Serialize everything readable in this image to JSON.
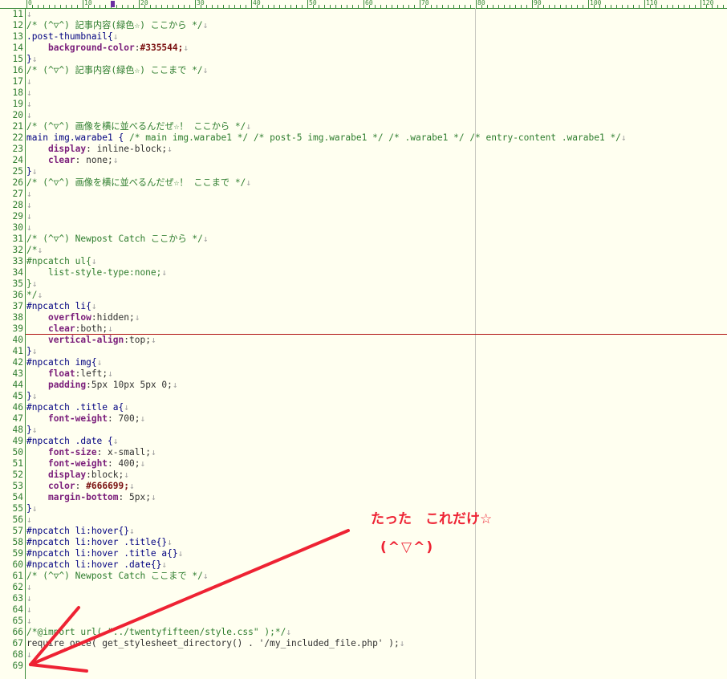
{
  "ruler": {
    "labels": [
      "0",
      "10",
      "20",
      "30",
      "40",
      "50",
      "60",
      "70",
      "80",
      "90",
      "100",
      "110",
      "120"
    ]
  },
  "eol_glyph": "↓",
  "lines": [
    {
      "n": "11",
      "t": [],
      "eol": true
    },
    {
      "n": "12",
      "t": [
        [
          "c-comment",
          "/* (^▽^) 記事内容(緑色☆) ここから */"
        ]
      ],
      "eol": true
    },
    {
      "n": "13",
      "t": [
        [
          "c-sel",
          ".post-thumbnail{"
        ]
      ],
      "eol": true
    },
    {
      "n": "14",
      "t": [
        [
          "",
          "    "
        ],
        [
          "c-prop",
          "background-color"
        ],
        [
          "c-punc",
          ":"
        ],
        [
          "c-color",
          "#335544;"
        ]
      ],
      "eol": true
    },
    {
      "n": "15",
      "t": [
        [
          "c-sel",
          "}"
        ]
      ],
      "eol": true
    },
    {
      "n": "16",
      "t": [
        [
          "c-comment",
          "/* (^▽^) 記事内容(緑色☆) ここまで */"
        ]
      ],
      "eol": true
    },
    {
      "n": "17",
      "t": [],
      "eol": true
    },
    {
      "n": "18",
      "t": [],
      "eol": true
    },
    {
      "n": "19",
      "t": [],
      "eol": true
    },
    {
      "n": "20",
      "t": [],
      "eol": true
    },
    {
      "n": "21",
      "t": [
        [
          "c-comment",
          "/* (^▽^) 画像を横に並べるんだぜ☆！ ここから */"
        ]
      ],
      "eol": true
    },
    {
      "n": "22",
      "t": [
        [
          "c-sel",
          "main img.warabe1 { "
        ],
        [
          "c-comment",
          "/* main img.warabe1 */ /* post-5 img.warabe1 */ /* .warabe1 */ /* entry-content .warabe1 */"
        ]
      ],
      "eol": true
    },
    {
      "n": "23",
      "t": [
        [
          "",
          "    "
        ],
        [
          "c-prop",
          "display"
        ],
        [
          "c-punc",
          ": inline-block;"
        ]
      ],
      "eol": true
    },
    {
      "n": "24",
      "t": [
        [
          "",
          "    "
        ],
        [
          "c-prop",
          "clear"
        ],
        [
          "c-punc",
          ": none;"
        ]
      ],
      "eol": true
    },
    {
      "n": "25",
      "t": [
        [
          "c-sel",
          "}"
        ]
      ],
      "eol": true
    },
    {
      "n": "26",
      "t": [
        [
          "c-comment",
          "/* (^▽^) 画像を横に並べるんだぜ☆！ ここまで */"
        ]
      ],
      "eol": true
    },
    {
      "n": "27",
      "t": [],
      "eol": true
    },
    {
      "n": "28",
      "t": [],
      "eol": true
    },
    {
      "n": "29",
      "t": [],
      "eol": true
    },
    {
      "n": "30",
      "t": [],
      "eol": true
    },
    {
      "n": "31",
      "t": [
        [
          "c-comment",
          "/* (^▽^) Newpost Catch ここから */"
        ]
      ],
      "eol": true
    },
    {
      "n": "32",
      "t": [
        [
          "c-comment",
          "/*"
        ]
      ],
      "eol": true
    },
    {
      "n": "33",
      "t": [
        [
          "c-comment",
          "#npcatch ul{"
        ]
      ],
      "eol": true
    },
    {
      "n": "34",
      "t": [
        [
          "c-comment",
          "    list-style-type:none;"
        ]
      ],
      "eol": true
    },
    {
      "n": "35",
      "t": [
        [
          "c-comment",
          "}"
        ]
      ],
      "eol": true
    },
    {
      "n": "36",
      "t": [
        [
          "c-comment",
          "*/"
        ]
      ],
      "eol": true
    },
    {
      "n": "37",
      "t": [
        [
          "c-sel",
          "#npcatch li{"
        ]
      ],
      "eol": true
    },
    {
      "n": "38",
      "t": [
        [
          "",
          "    "
        ],
        [
          "c-prop",
          "overflow"
        ],
        [
          "c-punc",
          ":hidden;"
        ]
      ],
      "eol": true
    },
    {
      "n": "39",
      "t": [
        [
          "",
          "    "
        ],
        [
          "c-prop",
          "clear"
        ],
        [
          "c-punc",
          ":both;"
        ]
      ],
      "eol": true,
      "cursor": true
    },
    {
      "n": "40",
      "t": [
        [
          "",
          "    "
        ],
        [
          "c-prop",
          "vertical-align"
        ],
        [
          "c-punc",
          ":top;"
        ]
      ],
      "eol": true
    },
    {
      "n": "41",
      "t": [
        [
          "c-sel",
          "}"
        ]
      ],
      "eol": true
    },
    {
      "n": "42",
      "t": [
        [
          "c-sel",
          "#npcatch img{"
        ]
      ],
      "eol": true
    },
    {
      "n": "43",
      "t": [
        [
          "",
          "    "
        ],
        [
          "c-prop",
          "float"
        ],
        [
          "c-punc",
          ":left;"
        ]
      ],
      "eol": true
    },
    {
      "n": "44",
      "t": [
        [
          "",
          "    "
        ],
        [
          "c-prop",
          "padding"
        ],
        [
          "c-punc",
          ":5px 10px 5px 0;"
        ]
      ],
      "eol": true
    },
    {
      "n": "45",
      "t": [
        [
          "c-sel",
          "}"
        ]
      ],
      "eol": true
    },
    {
      "n": "46",
      "t": [
        [
          "c-sel",
          "#npcatch .title a{"
        ]
      ],
      "eol": true
    },
    {
      "n": "47",
      "t": [
        [
          "",
          "    "
        ],
        [
          "c-prop",
          "font-weight"
        ],
        [
          "c-punc",
          ": 700;"
        ]
      ],
      "eol": true
    },
    {
      "n": "48",
      "t": [
        [
          "c-sel",
          "}"
        ]
      ],
      "eol": true
    },
    {
      "n": "49",
      "t": [
        [
          "c-sel",
          "#npcatch .date {"
        ]
      ],
      "eol": true
    },
    {
      "n": "50",
      "t": [
        [
          "",
          "    "
        ],
        [
          "c-prop",
          "font-size"
        ],
        [
          "c-punc",
          ": x-small;"
        ]
      ],
      "eol": true
    },
    {
      "n": "51",
      "t": [
        [
          "",
          "    "
        ],
        [
          "c-prop",
          "font-weight"
        ],
        [
          "c-punc",
          ": 400;"
        ]
      ],
      "eol": true
    },
    {
      "n": "52",
      "t": [
        [
          "",
          "    "
        ],
        [
          "c-prop",
          "display"
        ],
        [
          "c-punc",
          ":block;"
        ]
      ],
      "eol": true
    },
    {
      "n": "53",
      "t": [
        [
          "",
          "    "
        ],
        [
          "c-prop",
          "color"
        ],
        [
          "c-punc",
          ": "
        ],
        [
          "c-color",
          "#666699;"
        ]
      ],
      "eol": true
    },
    {
      "n": "54",
      "t": [
        [
          "",
          "    "
        ],
        [
          "c-prop",
          "margin-bottom"
        ],
        [
          "c-punc",
          ": 5px;"
        ]
      ],
      "eol": true
    },
    {
      "n": "55",
      "t": [
        [
          "c-sel",
          "}"
        ]
      ],
      "eol": true
    },
    {
      "n": "56",
      "t": [],
      "eol": true
    },
    {
      "n": "57",
      "t": [
        [
          "c-sel",
          "#npcatch li:hover{}"
        ]
      ],
      "eol": true
    },
    {
      "n": "58",
      "t": [
        [
          "c-sel",
          "#npcatch li:hover .title{}"
        ]
      ],
      "eol": true
    },
    {
      "n": "59",
      "t": [
        [
          "c-sel",
          "#npcatch li:hover .title a{}"
        ]
      ],
      "eol": true
    },
    {
      "n": "60",
      "t": [
        [
          "c-sel",
          "#npcatch li:hover .date{}"
        ]
      ],
      "eol": true
    },
    {
      "n": "61",
      "t": [
        [
          "c-comment",
          "/* (^▽^) Newpost Catch ここまで */"
        ]
      ],
      "eol": true
    },
    {
      "n": "62",
      "t": [],
      "eol": true
    },
    {
      "n": "63",
      "t": [],
      "eol": true
    },
    {
      "n": "64",
      "t": [],
      "eol": true
    },
    {
      "n": "65",
      "t": [],
      "eol": true
    },
    {
      "n": "66",
      "t": [
        [
          "c-comment",
          "/*@import url( \"../twentyfifteen/style.css\" );*/"
        ]
      ],
      "eol": true
    },
    {
      "n": "67",
      "t": [
        [
          "c-punc",
          "require_once( get_stylesheet_directory() . '/my_included_file.php' );"
        ]
      ],
      "eol": true
    },
    {
      "n": "68",
      "t": [],
      "eol": true
    },
    {
      "n": "69",
      "t": [],
      "eol": false
    }
  ],
  "annotation": {
    "line1": "たった　これだけ☆",
    "line2": "(^▽^)",
    "color": "#ee2233"
  }
}
